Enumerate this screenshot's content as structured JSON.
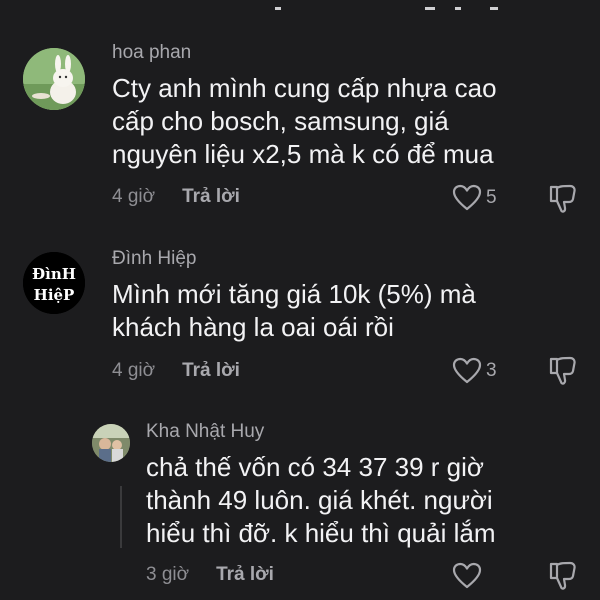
{
  "comments": [
    {
      "username": "hoa phan",
      "text": "Cty anh mình cung cấp nhựa cao\ncấp cho bosch, samsung, giá\nnguyên liệu x2,5 mà k có để mua",
      "time": "4 giờ",
      "reply_label": "Trả lời",
      "likes": "5",
      "avatar_icon": "bunny-avatar-icon"
    },
    {
      "username": "Đình Hiệp",
      "text": "Mình mới tăng giá 10k (5%) mà\nkhách hàng la oai oái rồi",
      "time": "4 giờ",
      "reply_label": "Trả lời",
      "likes": "3",
      "avatar_text_top": "ĐìnH",
      "avatar_text_bottom": "HiệP"
    },
    {
      "username": "Kha Nhật Huy",
      "text": "chả thế vốn có 34 37 39 r giờ\nthành 49 luôn. giá khét. người\nhiểu thì đỡ. k hiểu thì quải lắm",
      "time": "3 giờ",
      "reply_label": "Trả lời",
      "likes": "",
      "avatar_icon": "photo-avatar-icon"
    }
  ],
  "colors": {
    "background": "#1c1c1e",
    "username": "#a8a8ad",
    "text": "#f2f2f4",
    "meta": "#8e8e93"
  }
}
